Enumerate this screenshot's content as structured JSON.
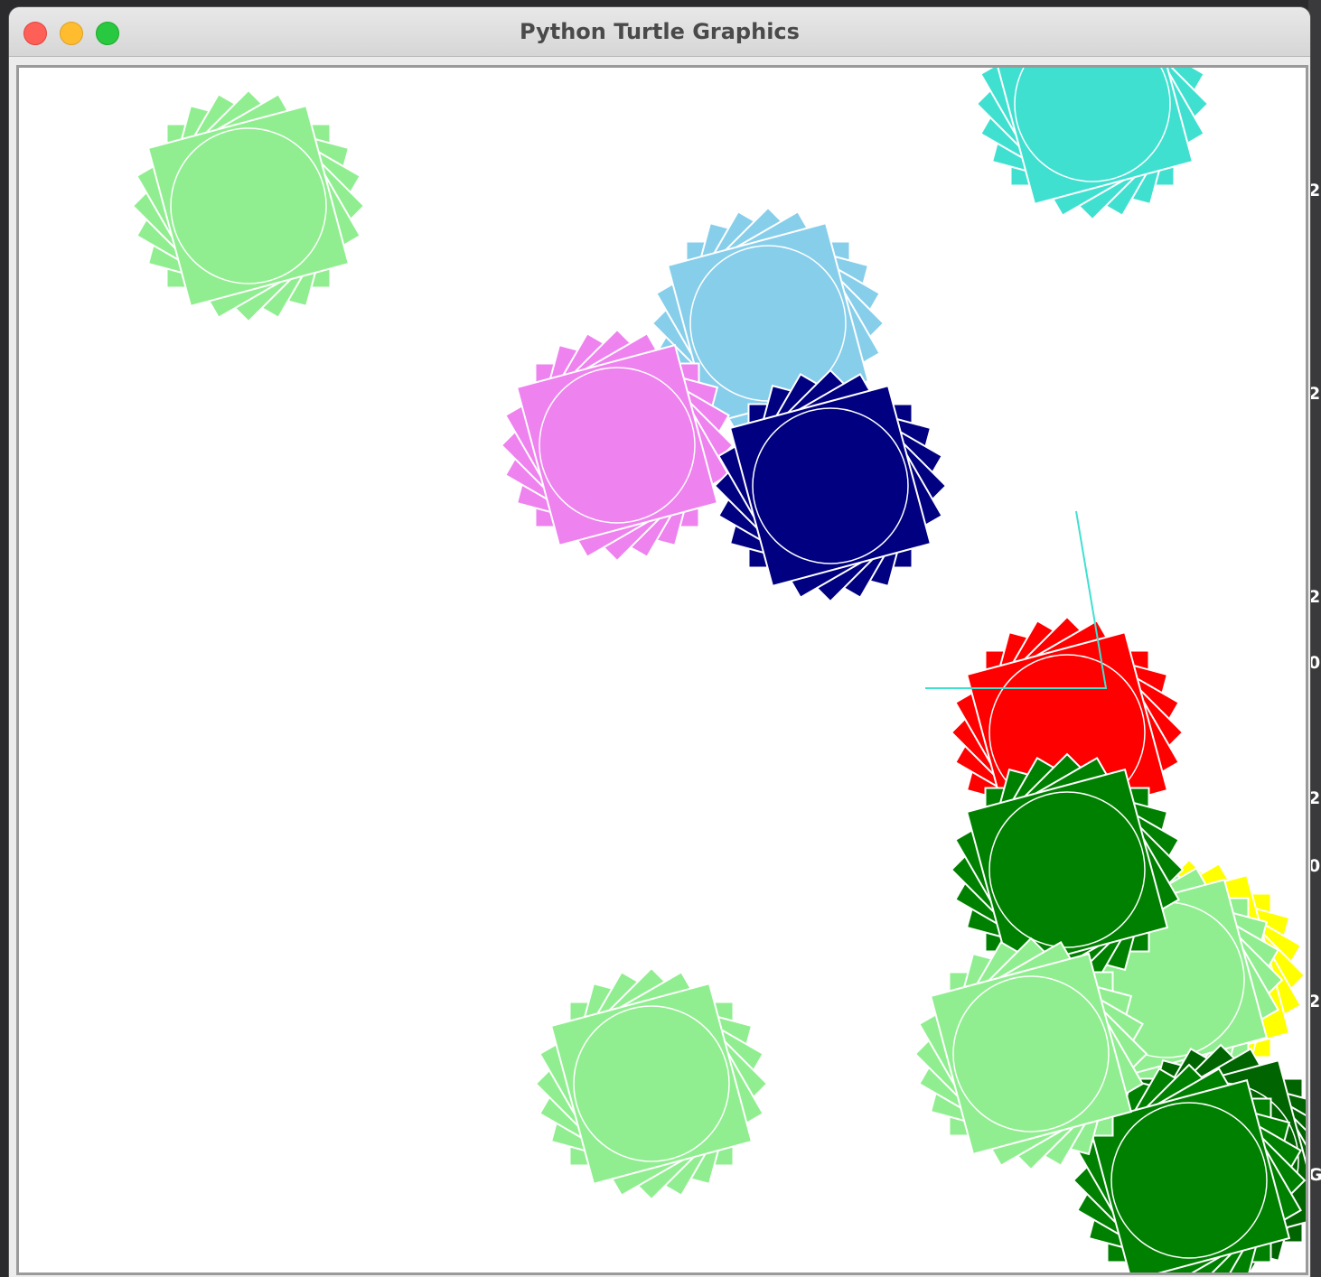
{
  "window": {
    "title": "Python Turtle Graphics"
  },
  "background_edge_digits": [
    "2",
    "2",
    "2",
    "0",
    "2",
    "0",
    "2",
    "G"
  ],
  "colors": {
    "canvas_background": "#ffffff",
    "turtle_line": "#40e0d0"
  },
  "shapes": [
    {
      "color": "lightgreen",
      "fill": "#90ee90"
    },
    {
      "color": "turquoise",
      "fill": "#40e0d0"
    },
    {
      "color": "skyblue",
      "fill": "#87ceeb"
    },
    {
      "color": "violet",
      "fill": "#ee82ee"
    },
    {
      "color": "navy",
      "fill": "#000080"
    },
    {
      "color": "red",
      "fill": "#ff0000"
    },
    {
      "color": "yellow",
      "fill": "#ffff00"
    },
    {
      "color": "lightgreen",
      "fill": "#90ee90"
    },
    {
      "color": "green",
      "fill": "#008000"
    },
    {
      "color": "darkgreen",
      "fill": "#006400"
    },
    {
      "color": "green",
      "fill": "#008000"
    },
    {
      "color": "lightgreen",
      "fill": "#90ee90"
    }
  ]
}
